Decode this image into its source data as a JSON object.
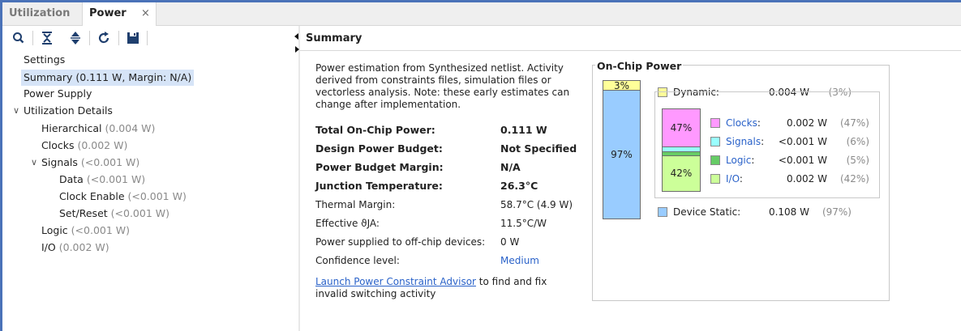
{
  "tabs": [
    {
      "label": "Utilization"
    },
    {
      "label": "Power",
      "close": "×"
    }
  ],
  "toolbar_icons": [
    "search-icon",
    "collapse-all-icon",
    "expand-all-icon",
    "refresh-icon",
    "save-icon"
  ],
  "tree": {
    "settings": "Settings",
    "summary": "Summary (0.111 W, Margin: N/A)",
    "power_supply": "Power Supply",
    "utilization_details": "Utilization Details",
    "hierarchical": {
      "label": "Hierarchical",
      "value": "(0.004 W)"
    },
    "clocks": {
      "label": "Clocks",
      "value": "(0.002 W)"
    },
    "signals": {
      "label": "Signals",
      "value": "(<0.001 W)"
    },
    "data": {
      "label": "Data",
      "value": "(<0.001 W)"
    },
    "clock_enable": {
      "label": "Clock Enable",
      "value": "(<0.001 W)"
    },
    "set_reset": {
      "label": "Set/Reset",
      "value": "(<0.001 W)"
    },
    "logic": {
      "label": "Logic",
      "value": "(<0.001 W)"
    },
    "io": {
      "label": "I/O",
      "value": "(0.002 W)"
    }
  },
  "summary": {
    "header": "Summary",
    "description": "Power estimation from Synthesized netlist. Activity derived from constraints files, simulation files or vectorless analysis. Note: these early estimates can change after implementation.",
    "rows": {
      "total_on_chip_power": {
        "label": "Total On-Chip Power:",
        "value": "0.111 W"
      },
      "design_power_budget": {
        "label": "Design Power Budget:",
        "value": "Not Specified"
      },
      "power_budget_margin": {
        "label": "Power Budget Margin:",
        "value": "N/A"
      },
      "junction_temperature": {
        "label": "Junction Temperature:",
        "value": "26.3°C"
      },
      "thermal_margin": {
        "label": "Thermal Margin:",
        "value": "58.7°C (4.9 W)"
      },
      "effective_theta_ja": {
        "label": "Effective ϑJA:",
        "value": "11.5°C/W"
      },
      "off_chip_power": {
        "label": "Power supplied to off-chip devices:",
        "value": "0 W"
      },
      "confidence_level": {
        "label": "Confidence level:",
        "value": "Medium"
      }
    },
    "launch_link": "Launch Power Constraint Advisor",
    "launch_text": " to find and fix invalid switching activity"
  },
  "on_chip_power": {
    "title": "On-Chip Power",
    "bar": {
      "dynamic_pct_label": "3%",
      "static_pct_label": "97%",
      "dynamic_fraction": 0.03,
      "static_fraction": 0.97
    },
    "dynamic": {
      "label": "Dynamic:",
      "value": "0.004 W",
      "pct": "(3%)",
      "color": "#ffff99"
    },
    "device_static": {
      "label": "Device Static:",
      "value": "0.108 W",
      "pct": "(97%)",
      "color": "#99ccff"
    },
    "breakdown": [
      {
        "label": "Clocks",
        "suffix": ":",
        "value": "0.002 W",
        "pct": "(47%)",
        "color": "#ff99ff",
        "bar_label": "47%",
        "fraction": 0.47
      },
      {
        "label": "Signals",
        "suffix": ":",
        "value": "<0.001 W",
        "pct": "(6%)",
        "color": "#99ffff",
        "bar_label": "",
        "fraction": 0.06
      },
      {
        "label": "Logic",
        "suffix": ":",
        "value": "<0.001 W",
        "pct": "(5%)",
        "color": "#66cc66",
        "bar_label": "",
        "fraction": 0.05
      },
      {
        "label": "I/O",
        "suffix": ":",
        "value": "0.002 W",
        "pct": "(42%)",
        "color": "#ccff99",
        "bar_label": "42%",
        "fraction": 0.42
      }
    ]
  }
}
